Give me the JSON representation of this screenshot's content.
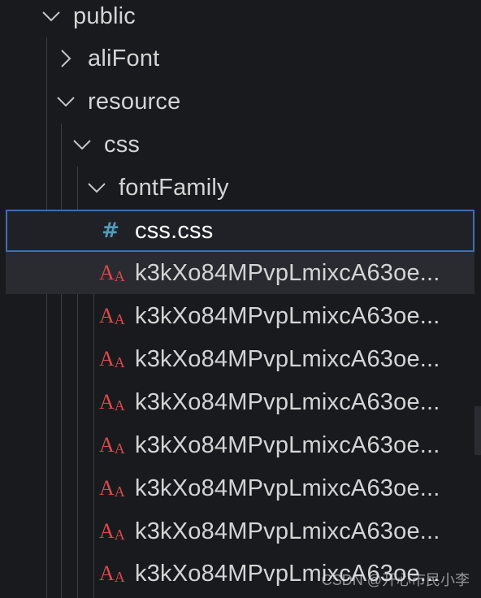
{
  "explorer": {
    "folders": [
      {
        "label": "public",
        "state": "expanded",
        "icon": "chevron-down-icon"
      },
      {
        "label": "aliFont",
        "state": "collapsed",
        "icon": "chevron-right-icon"
      },
      {
        "label": "resource",
        "state": "expanded",
        "icon": "chevron-down-icon"
      },
      {
        "label": "css",
        "state": "expanded",
        "icon": "chevron-down-icon"
      },
      {
        "label": "fontFamily",
        "state": "expanded",
        "icon": "chevron-down-icon"
      }
    ],
    "selected_file": {
      "label": "css.css",
      "icon": "css-hash-icon",
      "icon_glyph": "#"
    },
    "font_files": [
      {
        "label": "k3kXo84MPvpLmixcA63oe...",
        "icon": "font-file-icon"
      },
      {
        "label": "k3kXo84MPvpLmixcA63oe...",
        "icon": "font-file-icon"
      },
      {
        "label": "k3kXo84MPvpLmixcA63oe...",
        "icon": "font-file-icon"
      },
      {
        "label": "k3kXo84MPvpLmixcA63oe...",
        "icon": "font-file-icon"
      },
      {
        "label": "k3kXo84MPvpLmixcA63oe...",
        "icon": "font-file-icon"
      },
      {
        "label": "k3kXo84MPvpLmixcA63oe...",
        "icon": "font-file-icon"
      },
      {
        "label": "k3kXo84MPvpLmixcA63oe...",
        "icon": "font-file-icon"
      },
      {
        "label": "k3kXo84MPvpLmixcA63oe...",
        "icon": "font-file-icon"
      }
    ],
    "font_icon_glyph_big": "A",
    "font_icon_glyph_small": "A"
  },
  "watermark": "CSDN @开心市民小李",
  "colors": {
    "background": "#191a1e",
    "text": "#d4d4d4",
    "selection_border": "#3d6fb0",
    "css_icon": "#519aba",
    "font_icon": "#d84a4a"
  }
}
